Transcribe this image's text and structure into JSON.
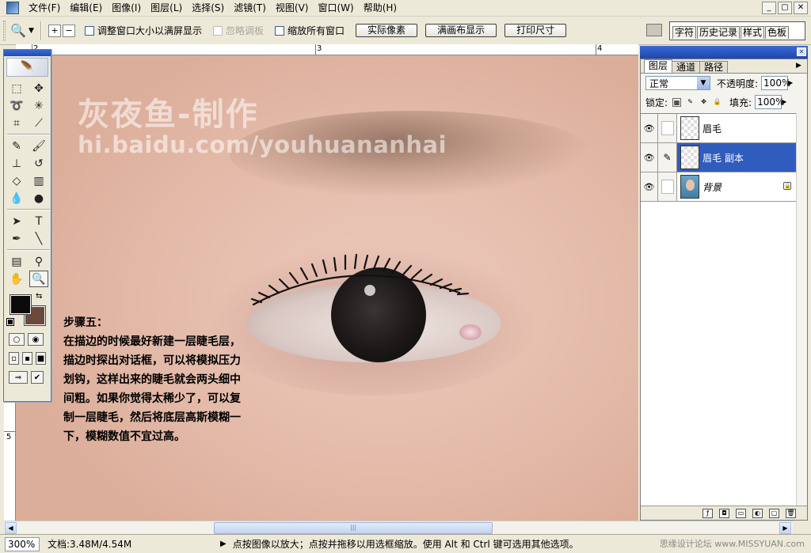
{
  "menubar": {
    "items": [
      "文件(F)",
      "编辑(E)",
      "图像(I)",
      "图层(L)",
      "选择(S)",
      "滤镜(T)",
      "视图(V)",
      "窗口(W)",
      "帮助(H)"
    ],
    "window_controls": [
      "_",
      "▢",
      "✕"
    ]
  },
  "options": {
    "zoom_in": "+",
    "zoom_out": "−",
    "resize_windows": "调整窗口大小以满屏显示",
    "ignore_palettes": "忽略调板",
    "zoom_all": "缩放所有窗口",
    "actual_pixels": "实际像素",
    "fit_on_screen": "满画布显示",
    "print_size": "打印尺寸",
    "well_tabs": [
      "字符",
      "历史记录",
      "样式",
      "色板"
    ]
  },
  "rulers": {
    "top": [
      "2",
      "3",
      "4"
    ],
    "left": [
      "5"
    ]
  },
  "canvas": {
    "watermark_title": "灰夜鱼-制作",
    "watermark_url": "hi.baidu.com/youhuananhai",
    "step_lines": [
      "步骤五：",
      "在描边的时候最好新建一层睫毛层，",
      "描边时探出对话框，可以将模拟压力",
      "划钩，这样出来的睫毛就会两头细中",
      "间粗。如果你觉得太稀少了，可以复",
      "制一层睫毛，然后将底层高斯模糊一",
      "下，模糊数值不宜过高。"
    ]
  },
  "colors": {
    "foreground": "#0b0b0b",
    "background": "#6b4a3a",
    "selection": "#2f5cbd"
  },
  "layers_panel": {
    "tabs": [
      "图层",
      "通道",
      "路径"
    ],
    "blend_mode": "正常",
    "opacity_label": "不透明度:",
    "opacity_value": "100%",
    "lock_label": "锁定:",
    "fill_label": "填充:",
    "fill_value": "100%",
    "layers": [
      {
        "name": "眉毛",
        "selected": false
      },
      {
        "name": "眉毛 副本",
        "selected": true
      },
      {
        "name": "背景",
        "selected": false,
        "locked": true
      }
    ]
  },
  "status": {
    "zoom": "300%",
    "doc_info": "文档:3.48M/4.54M",
    "message": "点按图像以放大；点按并拖移以用选框缩放。使用 Alt 和 Ctrl 键可选用其他选项。",
    "site_mark": "思缘设计论坛 www.MISSYUAN.com"
  }
}
